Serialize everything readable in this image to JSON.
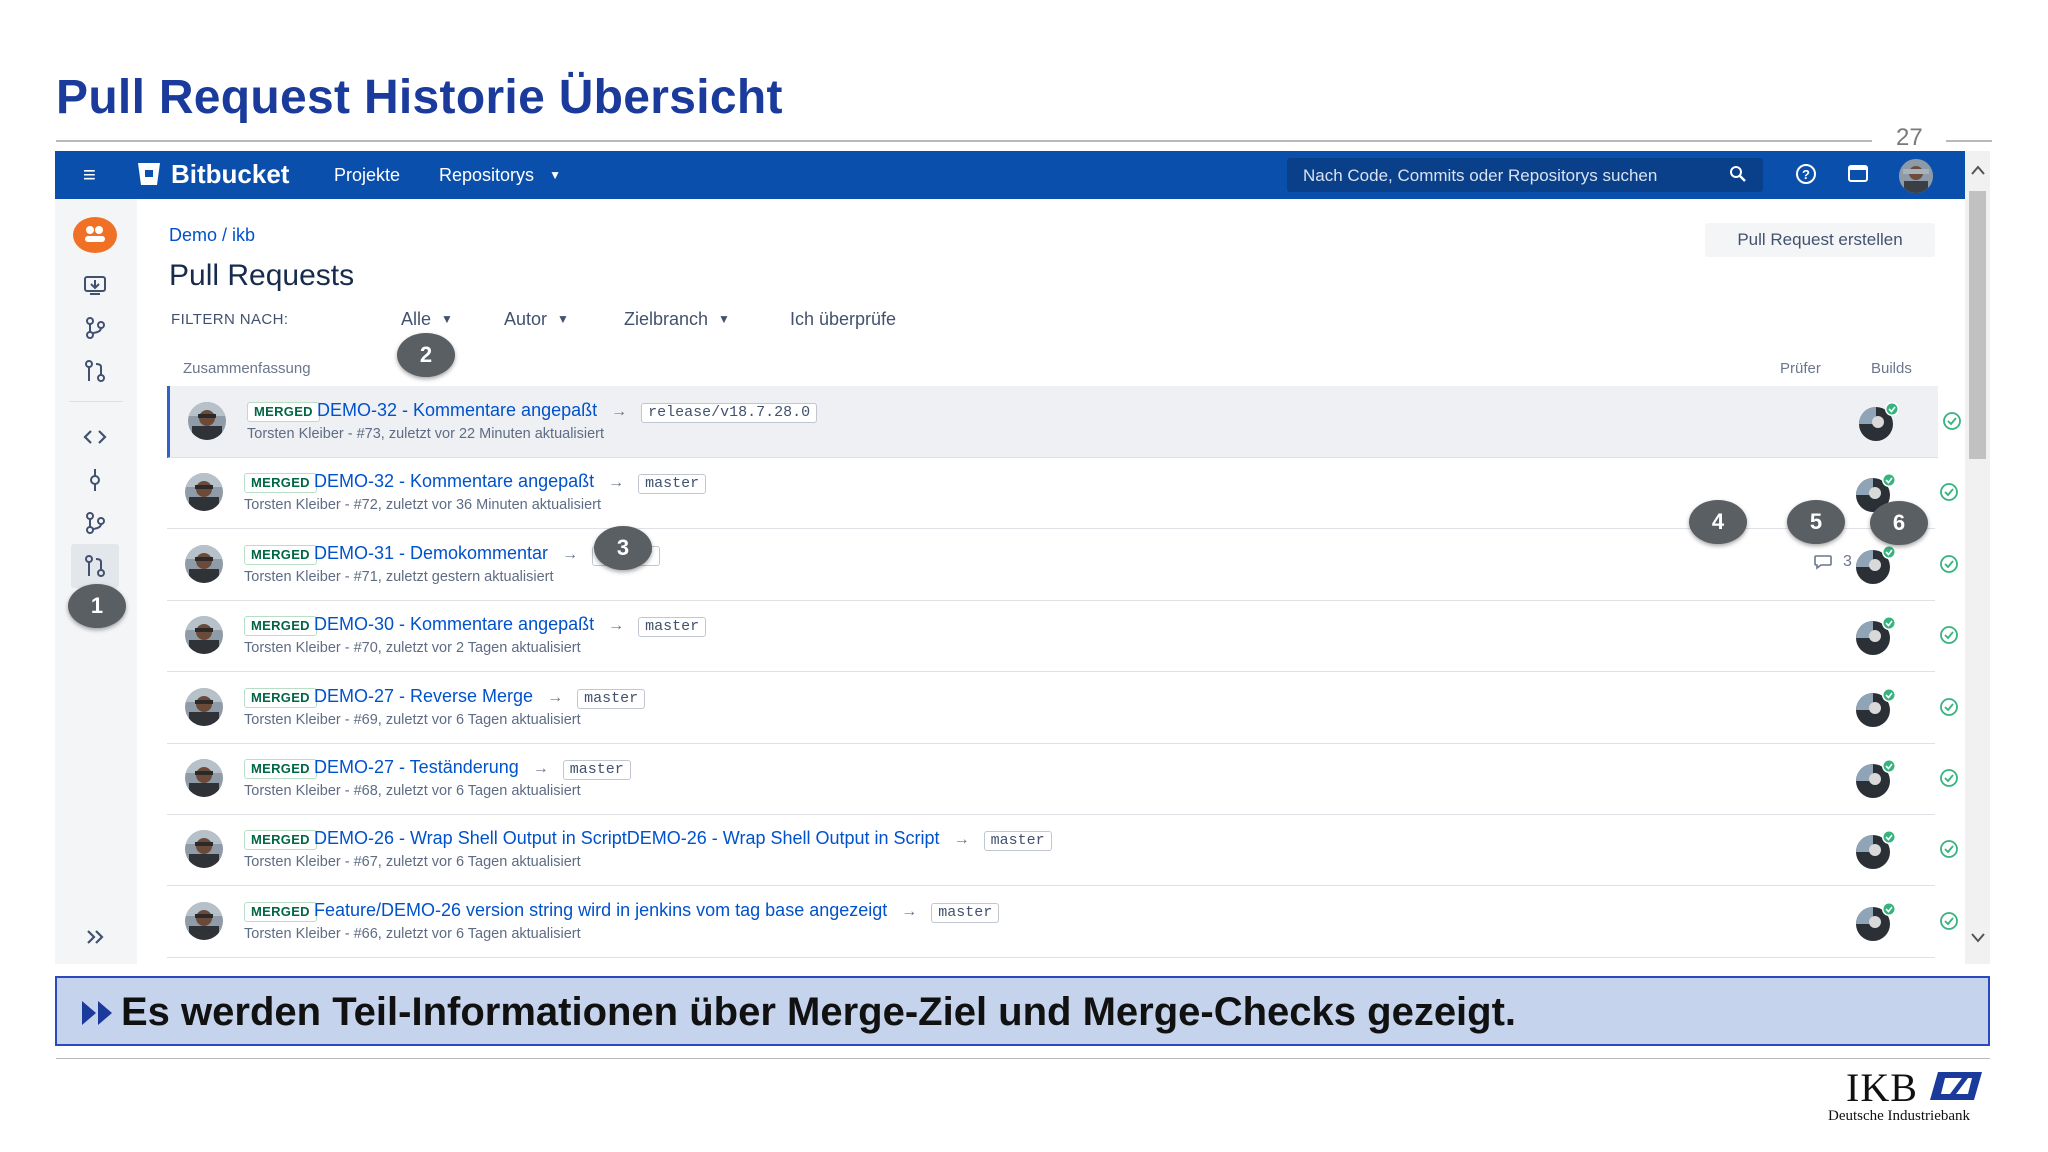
{
  "slide": {
    "title": "Pull Request Historie Übersicht",
    "page_number": "27",
    "bottom_text": "Es werden Teil-Informationen über Merge-Ziel und Merge-Checks gezeigt.",
    "logo_text": "IKB",
    "logo_subtitle": "Deutsche Industriebank"
  },
  "topnav": {
    "brand": "Bitbucket",
    "links": [
      "Projekte",
      "Repositorys"
    ],
    "search_placeholder": "Nach Code, Commits oder Repositorys suchen"
  },
  "page": {
    "breadcrumb": "Demo  /  ikb",
    "title": "Pull Requests",
    "create_button": "Pull Request erstellen",
    "filter_label": "FILTERN NACH:",
    "filters": [
      "Alle",
      "Autor",
      "Zielbranch",
      "Ich überprüfe"
    ],
    "columns": {
      "summary": "Zusammenfassung",
      "reviewer": "Prüfer",
      "builds": "Builds"
    }
  },
  "pull_requests": [
    {
      "status": "MERGED",
      "title": "DEMO-32 - Kommentare angepaßt",
      "target": "release/v18.7.28.0",
      "meta": "Torsten Kleiber - #73, zuletzt vor 22 Minuten aktualisiert",
      "comments": ""
    },
    {
      "status": "MERGED",
      "title": "DEMO-32 - Kommentare angepaßt",
      "target": "master",
      "meta": "Torsten Kleiber - #72, zuletzt vor 36 Minuten aktualisiert",
      "comments": ""
    },
    {
      "status": "MERGED",
      "title": "DEMO-31 - Demokommentar",
      "target": "master",
      "meta": "Torsten Kleiber - #71, zuletzt gestern aktualisiert",
      "comments": "3"
    },
    {
      "status": "MERGED",
      "title": "DEMO-30 - Kommentare angepaßt",
      "target": "master",
      "meta": "Torsten Kleiber - #70, zuletzt vor 2 Tagen aktualisiert",
      "comments": ""
    },
    {
      "status": "MERGED",
      "title": "DEMO-27 - Reverse Merge",
      "target": "master",
      "meta": "Torsten Kleiber - #69, zuletzt vor 6 Tagen aktualisiert",
      "comments": ""
    },
    {
      "status": "MERGED",
      "title": "DEMO-27 - Teständerung",
      "target": "master",
      "meta": "Torsten Kleiber - #68, zuletzt vor 6 Tagen aktualisiert",
      "comments": ""
    },
    {
      "status": "MERGED",
      "title": "DEMO-26 - Wrap Shell Output in ScriptDEMO-26 - Wrap Shell Output in Script",
      "target": "master",
      "meta": "Torsten Kleiber - #67, zuletzt vor 6 Tagen aktualisiert",
      "comments": ""
    },
    {
      "status": "MERGED",
      "title": "Feature/DEMO-26 version string wird in jenkins vom tag base angezeigt",
      "target": "master",
      "meta": "Torsten Kleiber - #66, zuletzt vor 6 Tagen aktualisiert",
      "comments": ""
    }
  ],
  "markers": [
    "1",
    "2",
    "3",
    "4",
    "5",
    "6"
  ],
  "colors": {
    "nav": "#0b4fad",
    "title": "#1a3a9c",
    "merged": "#006644",
    "link": "#0052cc",
    "build_ok": "#36b37e"
  },
  "icons": [
    "menu-icon",
    "bitbucket-logo-icon",
    "chevron-down-icon",
    "search-icon",
    "help-icon",
    "notifications-icon",
    "user-avatar",
    "source-icon",
    "commits-icon",
    "branches-icon",
    "pull-requests-icon",
    "collapse-sidebar-icon",
    "arrow-right-icon",
    "comment-icon",
    "check-circle-icon"
  ]
}
